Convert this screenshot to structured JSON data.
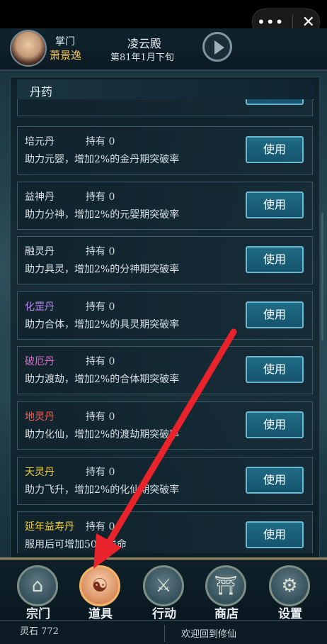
{
  "topbar": {
    "more_label": "•••",
    "close_label": "✕"
  },
  "header": {
    "rank": "掌门",
    "player_name": "萧景逸",
    "location": "凌云殿",
    "date": "第81年1月下旬",
    "play_icon": "play-icon"
  },
  "panel": {
    "title": "丹药"
  },
  "items": [
    {
      "name": "培元丹",
      "name_color": "#d9e3e7",
      "own": "持有 0",
      "desc": "助力元婴，增加2%的金丹期突破率",
      "button": "使用"
    },
    {
      "name": "益神丹",
      "name_color": "#d9e3e7",
      "own": "持有 0",
      "desc": "助力分神，增加2%的元婴期突破率",
      "button": "使用"
    },
    {
      "name": "融灵丹",
      "name_color": "#d9e3e7",
      "own": "持有 0",
      "desc": "助力具灵，增加2%的分神期突破率",
      "button": "使用"
    },
    {
      "name": "化罡丹",
      "name_color": "#b58cf0",
      "own": "持有 0",
      "desc": "助力合体，增加2%的具灵期突破率",
      "button": "使用"
    },
    {
      "name": "破厄丹",
      "name_color": "#e068c8",
      "own": "持有 0",
      "desc": "助力渡劫，增加2%的合体期突破率",
      "button": "使用"
    },
    {
      "name": "地灵丹",
      "name_color": "#ff5a4e",
      "own": "持有 0",
      "desc": "助力化仙，增加2%的渡劫期突破率",
      "button": "使用"
    },
    {
      "name": "天灵丹",
      "name_color": "#f4cf35",
      "own": "持有 0",
      "desc": "助力飞升，增加2%的化仙期突破率",
      "button": "使用"
    },
    {
      "name": "延年益寿丹",
      "name_color": "#f4cf35",
      "own": "持有 0",
      "desc": "服用后可增加50年寿命",
      "button": "使用"
    }
  ],
  "nav": [
    {
      "label": "宗门",
      "icon": "sect-icon",
      "glyph": "⌂"
    },
    {
      "label": "道具",
      "icon": "bag-icon",
      "glyph": "☯"
    },
    {
      "label": "行动",
      "icon": "sword-icon",
      "glyph": "⚔"
    },
    {
      "label": "商店",
      "icon": "shop-icon",
      "glyph": "⛩"
    },
    {
      "label": "设置",
      "icon": "gear-icon",
      "glyph": "⚙"
    }
  ],
  "footer": {
    "stones": "灵石 772",
    "welcome": "欢迎回到修仙"
  }
}
